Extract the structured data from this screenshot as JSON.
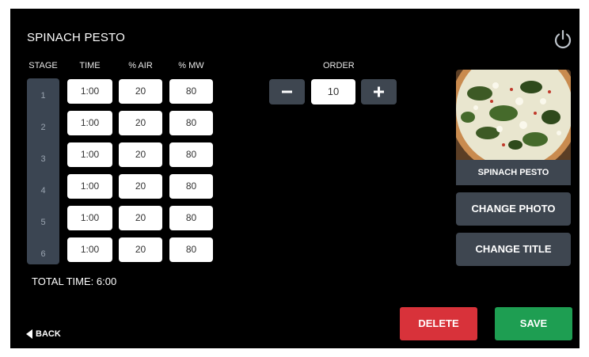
{
  "recipe": {
    "title": "SPINACH PESTO"
  },
  "icons": {
    "power": "power-icon",
    "back": "back-triangle-icon",
    "minus": "minus-icon",
    "plus": "plus-icon"
  },
  "table": {
    "headers": {
      "stage": "STAGE",
      "time": "TIME",
      "air": "% AIR",
      "mw": "% MW"
    },
    "rows": [
      {
        "stage": "1",
        "time": "1:00",
        "air": "20",
        "mw": "80"
      },
      {
        "stage": "2",
        "time": "1:00",
        "air": "20",
        "mw": "80"
      },
      {
        "stage": "3",
        "time": "1:00",
        "air": "20",
        "mw": "80"
      },
      {
        "stage": "4",
        "time": "1:00",
        "air": "20",
        "mw": "80"
      },
      {
        "stage": "5",
        "time": "1:00",
        "air": "20",
        "mw": "80"
      },
      {
        "stage": "6",
        "time": "1:00",
        "air": "20",
        "mw": "80"
      }
    ]
  },
  "total_time": "TOTAL TIME: 6:00",
  "order": {
    "label": "ORDER",
    "value": "10"
  },
  "photo": {
    "label": "SPINACH PESTO"
  },
  "buttons": {
    "change_photo": "CHANGE PHOTO",
    "change_title": "CHANGE TITLE",
    "back": "BACK",
    "delete": "DELETE",
    "save": "SAVE"
  },
  "colors": {
    "background": "#000000",
    "panel": "#3e4650",
    "stage_column": "#3b4552",
    "delete": "#d8323a",
    "save": "#1e9e52"
  }
}
